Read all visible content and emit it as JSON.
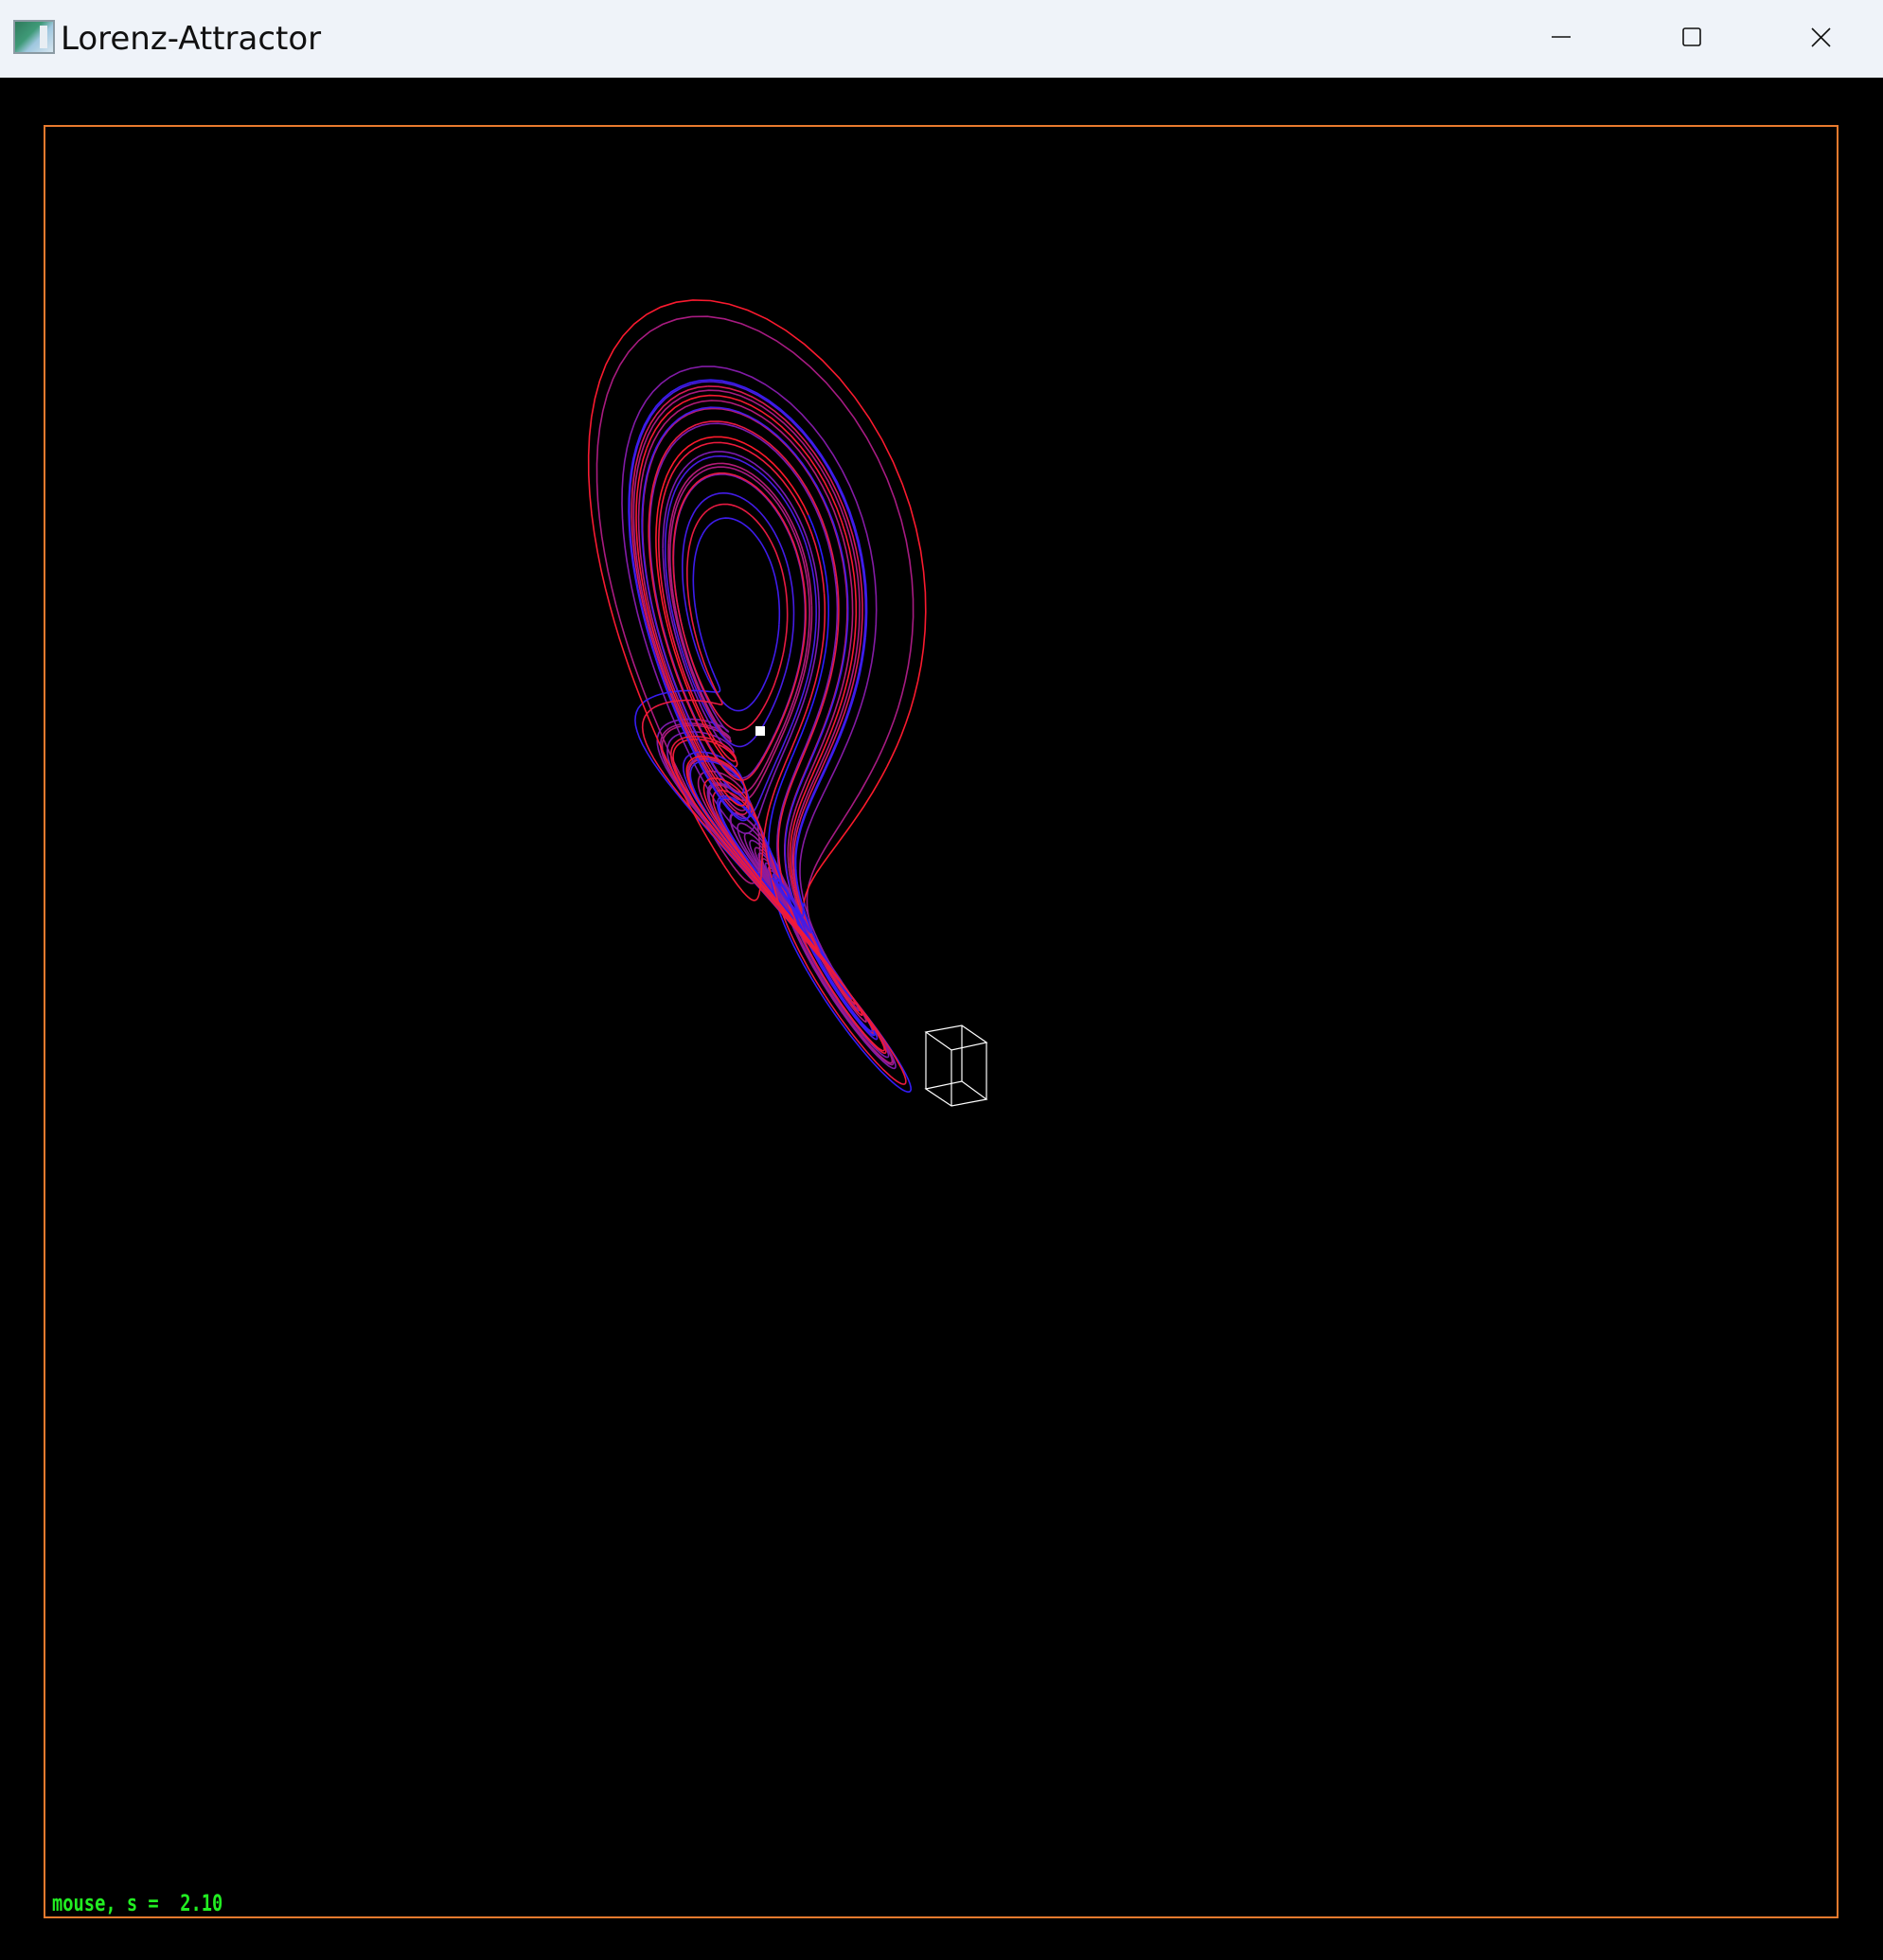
{
  "window": {
    "title": "Lorenz-Attractor",
    "icon": "application-window-icon",
    "controls": [
      "minimize-icon",
      "maximize-icon",
      "close-icon"
    ]
  },
  "viewport": {
    "background": "#000000",
    "frame_color": "#e87a2e",
    "status_text": "mouse, s =  2.10",
    "status_color": "#22ee22"
  },
  "attractor": {
    "colors": {
      "start": "#2a1cff",
      "end": "#ff1a2a"
    },
    "marker_color": "#ffffff",
    "cube_color": "#ffffff"
  }
}
